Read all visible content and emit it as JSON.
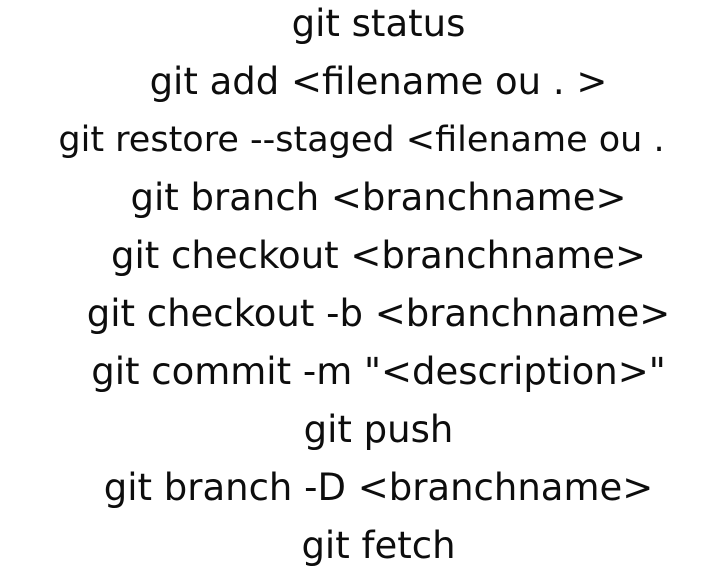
{
  "commands": [
    "git status",
    "git add <filename ou . >",
    "git restore --staged <filename ou .",
    "git branch <branchname>",
    "git checkout <branchname>",
    "git checkout -b <branchname>",
    "git commit -m \"<description>\"",
    "git push",
    "git branch -D <branchname>",
    "git fetch"
  ]
}
